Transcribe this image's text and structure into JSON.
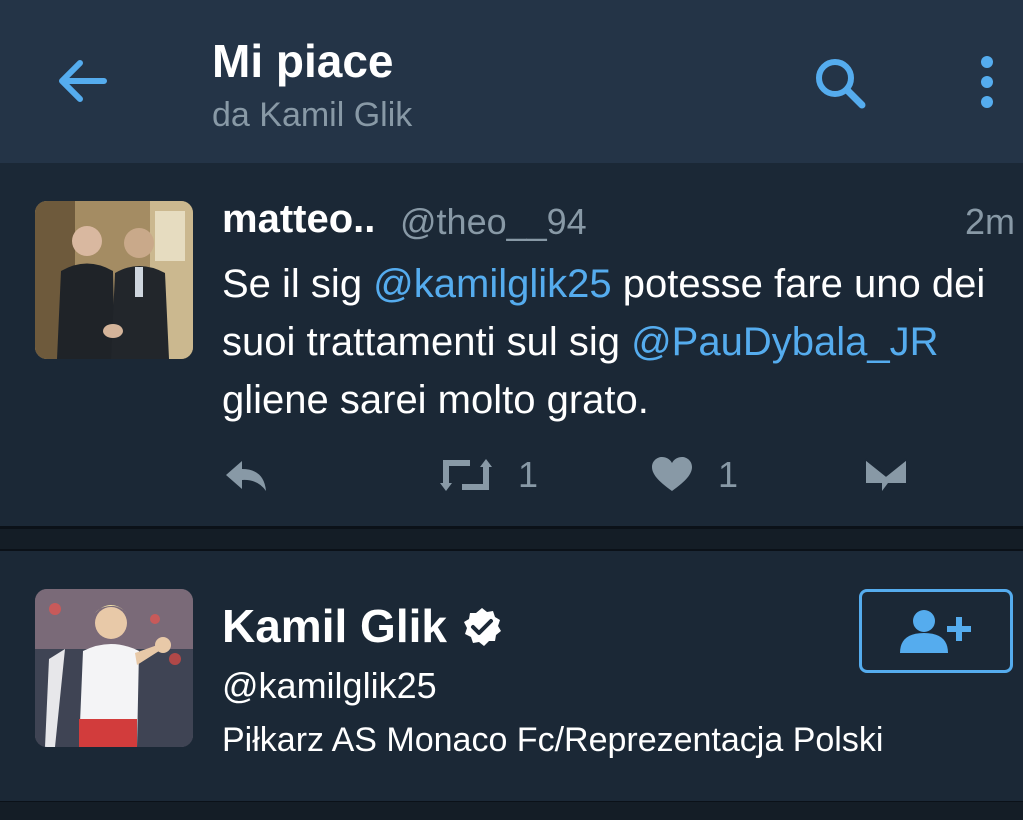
{
  "header": {
    "title": "Mi piace",
    "subtitle": "da Kamil Glik",
    "back_icon": "arrow-left-icon",
    "search_icon": "search-icon",
    "more_icon": "more-vertical-icon"
  },
  "tweet": {
    "name": "matteo..",
    "handle": "@theo__94",
    "time": "2m",
    "text_part1": "Se il sig ",
    "mention1": "@kamilglik25",
    "text_part2": " potesse fare uno dei suoi trattamenti sul sig ",
    "mention2": "@PauDybala_JR",
    "text_part3": " gliene sarei molto grato.",
    "retweet_count": "1",
    "like_count": "1"
  },
  "user": {
    "name": "Kamil Glik",
    "handle": "@kamilglik25",
    "bio": "Piłkarz AS Monaco Fc/Reprezentacja Polski"
  },
  "colors": {
    "accent": "#55acee",
    "header_bg": "#243447",
    "card_bg": "#1b2836",
    "muted": "#8899a6"
  }
}
